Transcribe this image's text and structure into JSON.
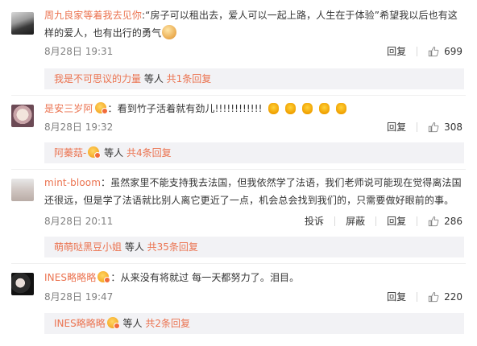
{
  "comments": [
    {
      "user": "周九良家等着我去见你",
      "text_before_emoji": ":“房子可以租出去，爱人可以一起上路，人生在于体验”希望我以后也有这样的爱人，也有出行的勇气",
      "time": "8月28日 19:31",
      "actions": [
        "回复"
      ],
      "likes": "699",
      "reply": {
        "user": "我是不可思议的力量",
        "tail": " 等人 ",
        "count": "共1条回复"
      }
    },
    {
      "user": "是安三岁阿",
      "text": "：看到竹子活着就有劲儿!!!!!!!!!!!!",
      "emoji_count": 5,
      "time": "8月28日 19:32",
      "actions": [
        "回复"
      ],
      "likes": "308",
      "reply": {
        "user": "阿蓁菇-",
        "tail": " 等人 ",
        "count": "共4条回复"
      }
    },
    {
      "user": "mint-bloom",
      "text": "：虽然家里不能支持我去法国，但我依然学了法语，我们老师说可能现在觉得离法国还很远，但是学了法语就比别人离它更近了一点，机会总会找到我们的，只需要做好眼前的事。",
      "time": "8月28日 20:11",
      "actions": [
        "投诉",
        "屏蔽",
        "回复"
      ],
      "likes": "286",
      "reply": {
        "user": "萌萌哒黑豆小姐",
        "tail": " 等人 ",
        "count": "共35条回复"
      }
    },
    {
      "user": "INES略略略",
      "text": "：从来没有将就过 每一天都努力了。泪目。",
      "time": "8月28日 19:47",
      "actions": [
        "回复"
      ],
      "likes": "220",
      "reply": {
        "user": "INES略略略",
        "tail": " 等人 ",
        "count": "共2条回复"
      }
    }
  ],
  "icons": {
    "like": "thumbs-up-icon",
    "badge": "member-badge-icon",
    "emoji": "emoji-icon"
  },
  "colors": {
    "username": "#eb7350",
    "meta": "#808080",
    "reply_bg": "#f2f2f5"
  }
}
